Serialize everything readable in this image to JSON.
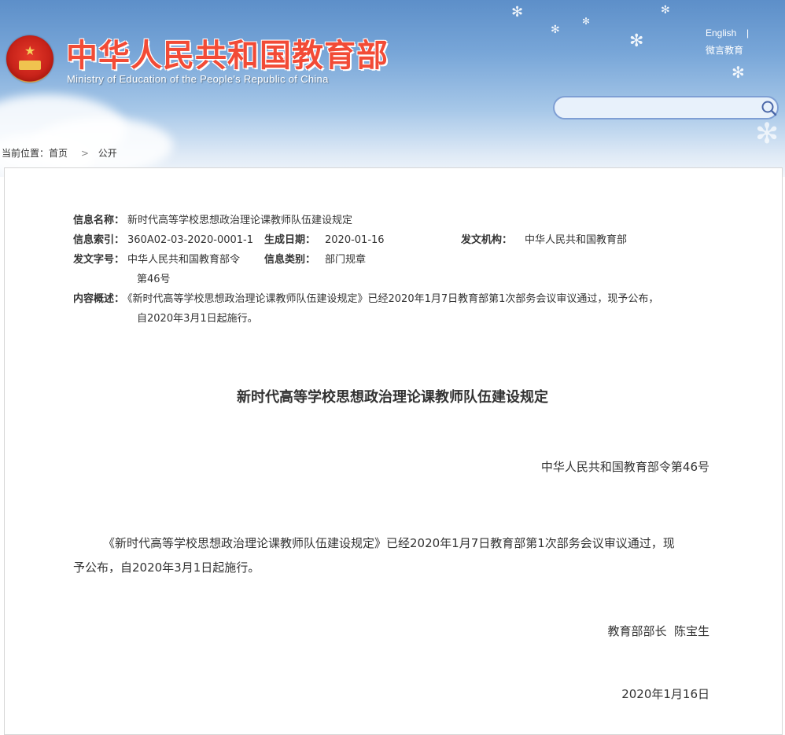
{
  "header": {
    "title_cn": "中华人民共和国教育部",
    "title_en": "Ministry of Education of the People's Republic of China",
    "links": [
      "English",
      "微言教育"
    ],
    "search_placeholder": ""
  },
  "breadcrumb": {
    "prefix": "当前位置：",
    "items": [
      "首页",
      "公开"
    ],
    "separator": ">"
  },
  "meta": {
    "name_label": "信息名称：",
    "name_value": "新时代高等学校思想政治理论课教师队伍建设规定",
    "index_label": "信息索引：",
    "index_value": "360A02-03-2020-0001-1",
    "date_label": "生成日期：",
    "date_value": "2020-01-16",
    "org_label": "发文机构：",
    "org_value": "中华人民共和国教育部",
    "docno_label": "发文字号：",
    "docno_value_line1": "中华人民共和国教育部令",
    "docno_value_line2": "第46号",
    "category_label": "信息类别：",
    "category_value": "部门规章",
    "summary_label": "内容概述：",
    "summary_line1": "《新时代高等学校思想政治理论课教师队伍建设规定》已经2020年1月7日教育部第1次部务会议审议通过，现予公布，",
    "summary_line2": "自2020年3月1日起施行。"
  },
  "document": {
    "title": "新时代高等学校思想政治理论课教师队伍建设规定",
    "order_no": "中华人民共和国教育部令第46号",
    "para_line1": "《新时代高等学校思想政治理论课教师队伍建设规定》已经2020年1月7日教育部第1次部务会议审议通过，现",
    "para_line2": "予公布，自2020年3月1日起施行。",
    "signer": "教育部部长  陈宝生",
    "date": "2020年1月16日"
  }
}
